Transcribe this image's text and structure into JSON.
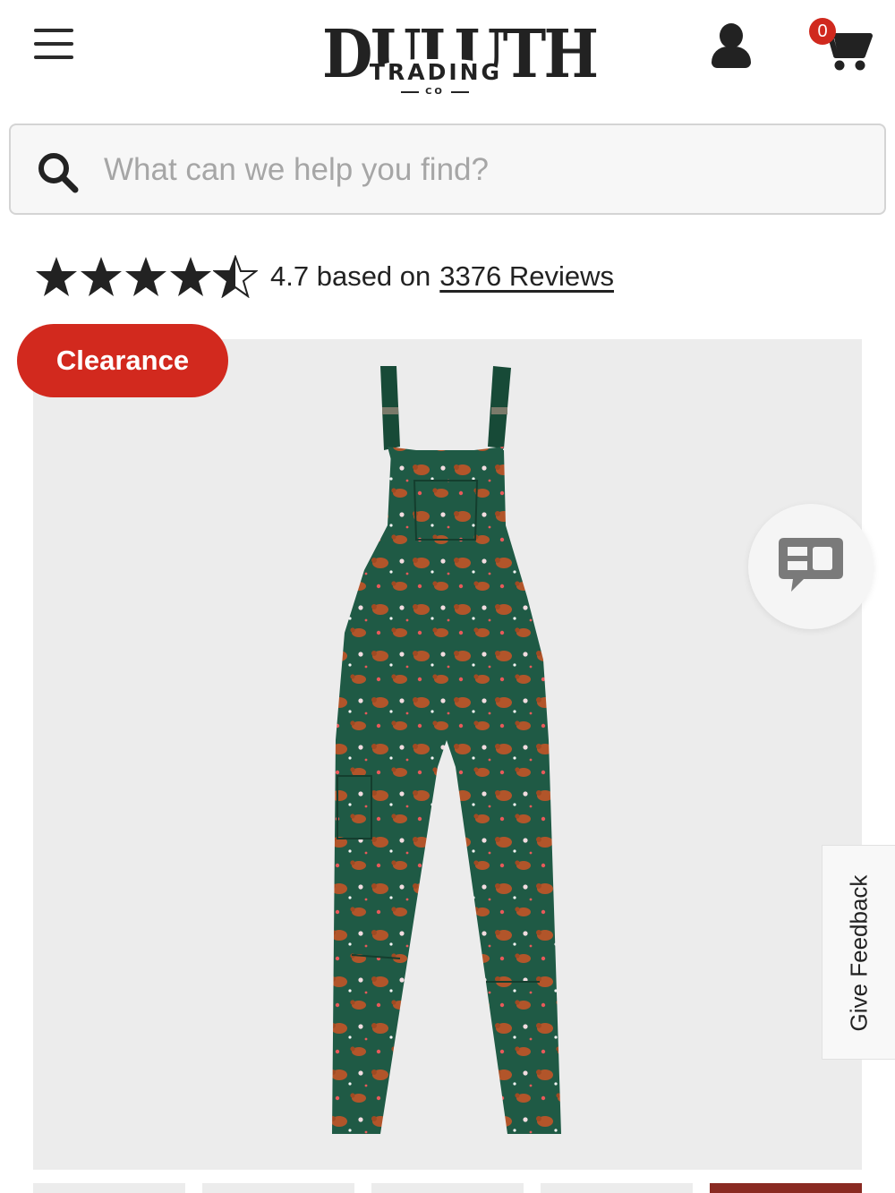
{
  "header": {
    "menu_icon": "hamburger-menu-icon",
    "logo": {
      "line1": "DULUTH",
      "line2": "TRADING",
      "line3": "CO"
    },
    "account_icon": "user-account-icon",
    "cart": {
      "icon": "shopping-cart-icon",
      "count": "0"
    }
  },
  "search": {
    "icon": "search-icon",
    "placeholder": "What can we help you find?",
    "value": ""
  },
  "rating": {
    "stars": 4.7,
    "max_stars": 5,
    "text": "4.7 based on",
    "reviews_link": "3376 Reviews"
  },
  "product": {
    "badge": "Clearance",
    "image": "green overalls with highland cow and floral print",
    "colors": {
      "fabric": "#1f5a45",
      "strap": "#174a37",
      "badge": "#d2291e"
    }
  },
  "floating": {
    "chat_icon": "chat-bubble-icon",
    "feedback_label": "Give Feedback"
  },
  "thumbnails": [
    {
      "active": false
    },
    {
      "active": false
    },
    {
      "active": false
    },
    {
      "active": false
    },
    {
      "active": true
    }
  ]
}
